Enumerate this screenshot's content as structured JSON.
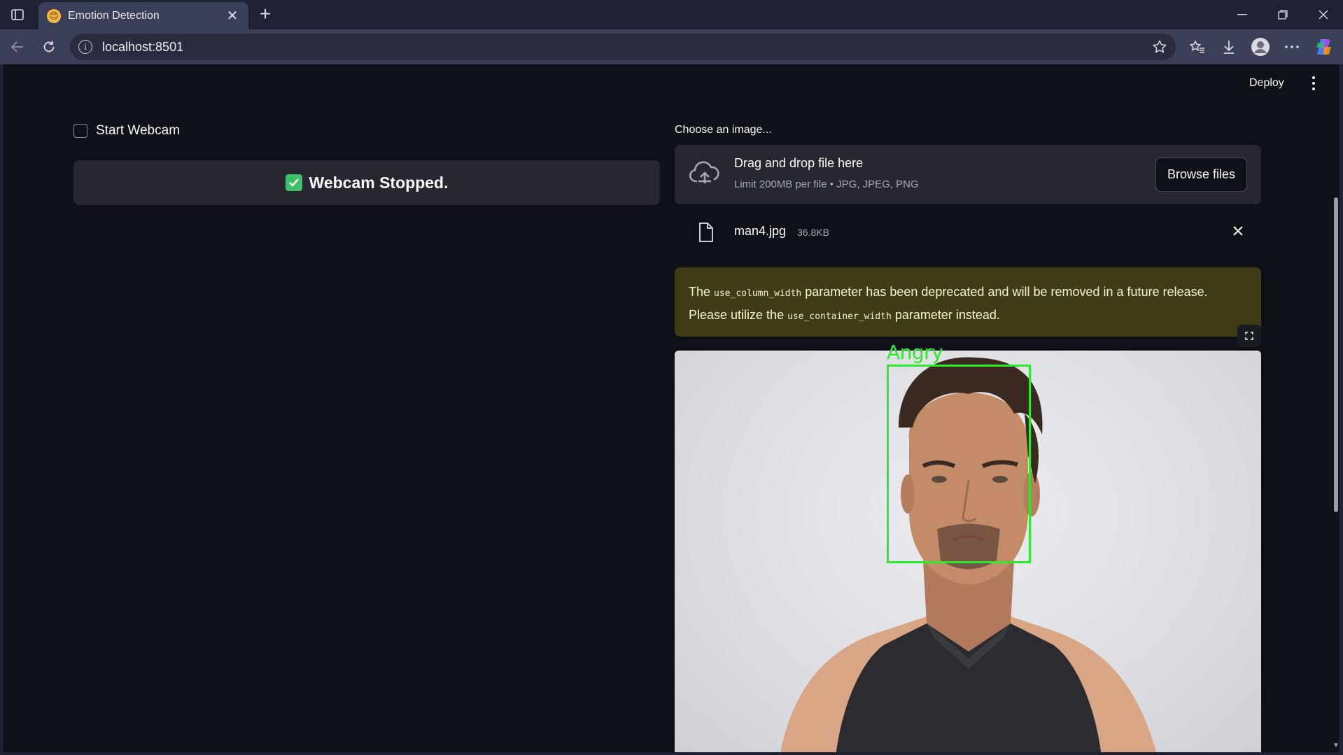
{
  "browser": {
    "tab_title": "Emotion Detection",
    "tab_favicon": "😊",
    "url": "localhost:8501"
  },
  "app": {
    "deploy_label": "Deploy",
    "webcam": {
      "checkbox_label": "Start Webcam",
      "checked": false,
      "status_text": "Webcam Stopped."
    },
    "uploader": {
      "label": "Choose an image...",
      "drop_title": "Drag and drop file here",
      "drop_limit": "Limit 200MB per file • JPG, JPEG, PNG",
      "browse_label": "Browse files",
      "file_name": "man4.jpg",
      "file_size": "36.8KB"
    },
    "warning": {
      "part1": "The ",
      "code1": "use_column_width",
      "part2": " parameter has been deprecated and will be removed in a future release.",
      "part3": "Please utilize the ",
      "code2": "use_container_width",
      "part4": " parameter instead."
    },
    "detection": {
      "emotion_label": "Angry",
      "box_color": "#2aea2a"
    }
  },
  "colors": {
    "app_bg": "#0e1118",
    "panel_bg": "#262730",
    "warning_bg": "#3e3d16",
    "success": "#3ec06a"
  }
}
